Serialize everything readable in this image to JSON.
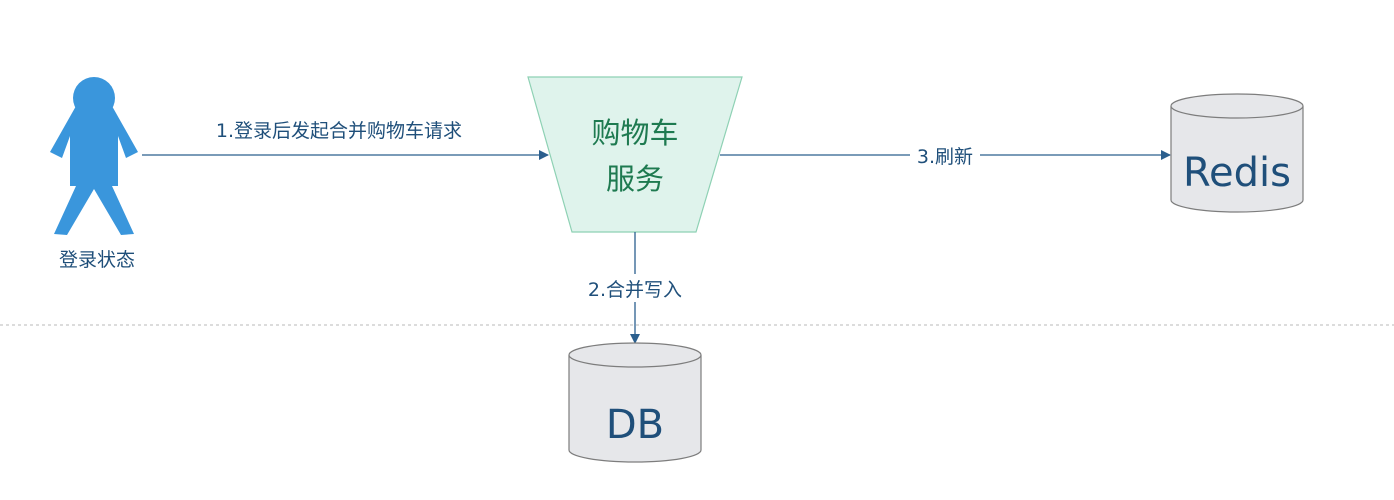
{
  "actor": {
    "label": "登录状态",
    "icon": "person-icon",
    "color": "#3a96dc"
  },
  "service": {
    "line1": "购物车",
    "line2": "服务",
    "fill": "#dff3ec",
    "stroke": "#8ed1b4"
  },
  "stores": {
    "redis": {
      "label": "Redis",
      "icon": "database-icon"
    },
    "db": {
      "label": "DB",
      "icon": "database-icon"
    },
    "fill": "#e6e7ea",
    "stroke": "#7d7d7d"
  },
  "arrows": {
    "merge_request": "1.登录后发起合并购物车请求",
    "merge_write": "2.合并写入",
    "refresh": "3.刷新",
    "color": "#2b5f8e"
  },
  "divider": {
    "style": "dashed",
    "color": "#b8b8b8"
  }
}
